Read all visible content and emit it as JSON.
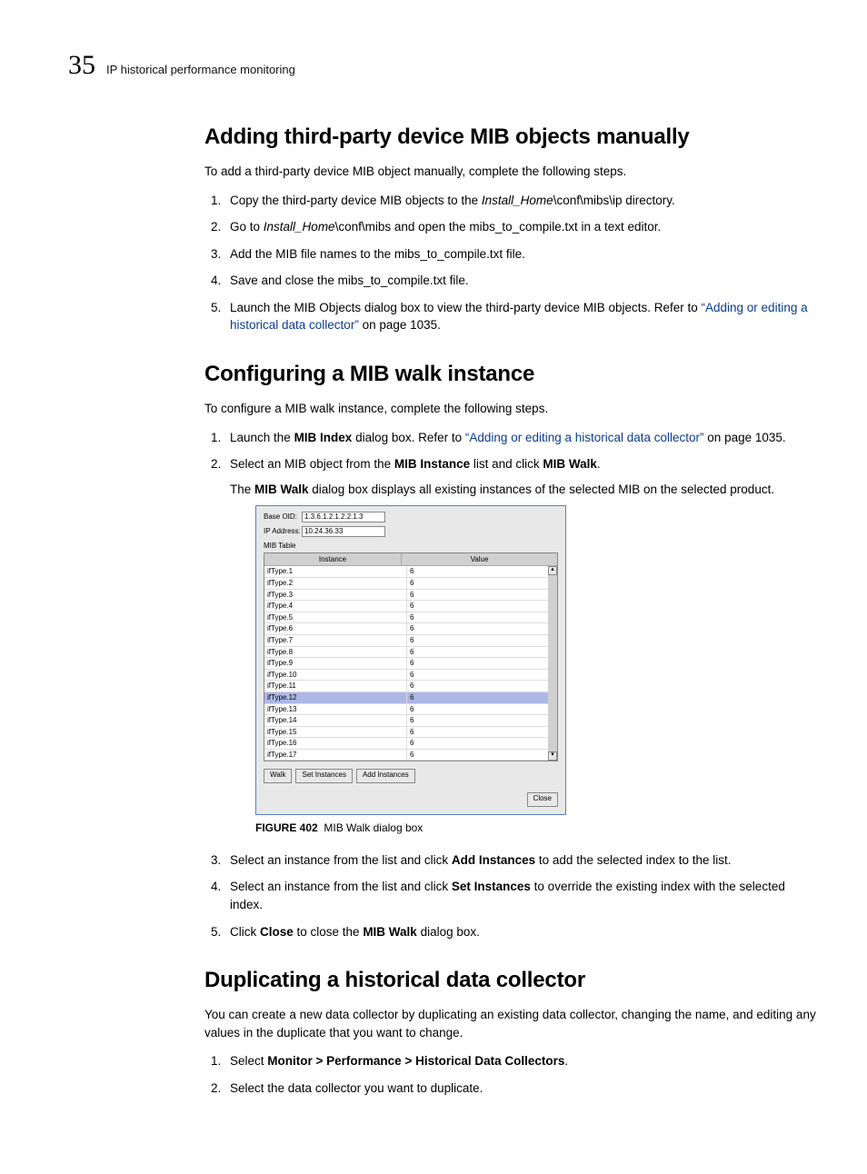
{
  "header": {
    "page_number": "35",
    "running_title": "IP historical performance monitoring"
  },
  "section1": {
    "title": "Adding third-party device MIB objects manually",
    "intro": "To add a third-party device MIB object manually, complete the following steps.",
    "steps": {
      "s1a": "Copy the third-party device MIB objects to the ",
      "s1b": "Install_Home",
      "s1c": "\\conf\\mibs\\ip directory.",
      "s2a": "Go to ",
      "s2b": "Install_Home",
      "s2c": "\\conf\\mibs and open the mibs_to_compile.txt in a text editor.",
      "s3": "Add the MIB file names to the mibs_to_compile.txt file.",
      "s4": "Save and close the mibs_to_compile.txt file.",
      "s5a": "Launch the MIB Objects dialog box to view the third-party device MIB objects. Refer to ",
      "s5link": "“Adding or editing a historical data collector”",
      "s5b": " on page 1035."
    }
  },
  "section2": {
    "title": "Configuring a MIB walk instance",
    "intro": "To configure a MIB walk instance, complete the following steps.",
    "steps": {
      "s1a": "Launch the ",
      "s1bold": "MIB Index",
      "s1b": " dialog box. Refer to ",
      "s1link": "“Adding or editing a historical data collector”",
      "s1c": " on page 1035.",
      "s2a": "Select an MIB object from the ",
      "s2bold1": "MIB Instance",
      "s2b": " list and click ",
      "s2bold2": "MIB Walk",
      "s2c": ".",
      "s2suba": "The ",
      "s2sub_bold": "MIB Walk",
      "s2subb": " dialog box displays all existing instances of the selected MIB on the selected product.",
      "s3a": "Select an instance from the list and click ",
      "s3bold": "Add Instances",
      "s3b": " to add the selected index to the list.",
      "s4a": "Select an instance from the list and click ",
      "s4bold": "Set Instances",
      "s4b": " to override the existing index with the selected index.",
      "s5a": "Click ",
      "s5bold1": "Close",
      "s5b": " to close the ",
      "s5bold2": "MIB Walk",
      "s5c": " dialog box."
    }
  },
  "figure": {
    "label": "FIGURE 402",
    "caption": "MIB Walk dialog box",
    "base_oid_label": "Base OID:",
    "base_oid_value": "1.3.6.1.2.1.2.2.1.3",
    "ip_label": "IP Address:",
    "ip_value": "10.24.36.33",
    "table_label": "MIB Table",
    "col_instance": "Instance",
    "col_value": "Value",
    "rows": [
      {
        "inst": "ifType.1",
        "val": "6"
      },
      {
        "inst": "ifType.2",
        "val": "6"
      },
      {
        "inst": "ifType.3",
        "val": "6"
      },
      {
        "inst": "ifType.4",
        "val": "6"
      },
      {
        "inst": "ifType.5",
        "val": "6"
      },
      {
        "inst": "ifType.6",
        "val": "6"
      },
      {
        "inst": "ifType.7",
        "val": "6"
      },
      {
        "inst": "ifType.8",
        "val": "6"
      },
      {
        "inst": "ifType.9",
        "val": "6"
      },
      {
        "inst": "ifType.10",
        "val": "6"
      },
      {
        "inst": "ifType.11",
        "val": "6"
      },
      {
        "inst": "ifType.12",
        "val": "6"
      },
      {
        "inst": "ifType.13",
        "val": "6"
      },
      {
        "inst": "ifType.14",
        "val": "6"
      },
      {
        "inst": "ifType.15",
        "val": "6"
      },
      {
        "inst": "ifType.16",
        "val": "6"
      },
      {
        "inst": "ifType.17",
        "val": "6"
      }
    ],
    "selected_index": 11,
    "btn_walk": "Walk",
    "btn_set": "Set Instances",
    "btn_add": "Add Instances",
    "btn_close": "Close"
  },
  "section3": {
    "title": "Duplicating a historical data collector",
    "intro": "You can create a new data collector by duplicating an existing data collector, changing the name, and editing any values in the duplicate that you want to change.",
    "steps": {
      "s1a": "Select ",
      "s1bold": "Monitor > Performance > Historical Data Collectors",
      "s1b": ".",
      "s2": "Select the data collector you want to duplicate."
    }
  }
}
